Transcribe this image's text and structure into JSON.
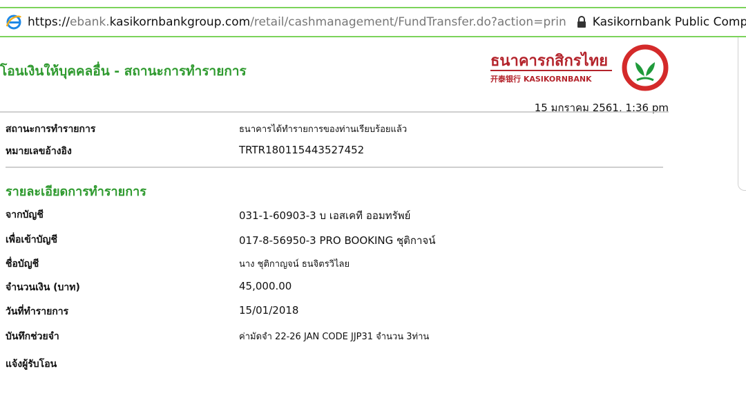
{
  "browser": {
    "url_scheme": "https://",
    "url_prefix": "ebank.",
    "url_domain": "kasikornbankgroup.com",
    "url_path": "/retail/cashmanagement/FundTransfer.do?action=prin",
    "site_identity": "Kasikornbank Public Company Li"
  },
  "header": {
    "page_title": "โอนเงินให้บุคคลอื่น - สถานะการทำรายการ",
    "logo_thai": "ธนาคารกสิกรไทย",
    "logo_sub": "开泰银行 KASIKORNBANK",
    "timestamp": "15 มกราคม 2561, 1:36 pm"
  },
  "status_rows": [
    {
      "label": "สถานะการทำรายการ",
      "value": "ธนาคารได้ทำรายการของท่านเรียบร้อยแล้ว"
    },
    {
      "label": "หมายเลขอ้างอิง",
      "value": "TRTR180115443527452"
    }
  ],
  "details": {
    "heading": "รายละเอียดการทำรายการ",
    "rows": [
      {
        "label": "จากบัญชี",
        "value": "031-1-60903-3 บ เอสเคที ออมทรัพย์"
      },
      {
        "label": "เพื่อเข้าบัญชี",
        "value": "017-8-56950-3 PRO BOOKING ชุติกาจน์"
      },
      {
        "label": "ชื่อบัญชี",
        "value": "นาง ชุติกาญจน์ ธนจิตรวิไลย"
      },
      {
        "label": "จำนวนเงิน (บาท)",
        "value": "45,000.00"
      },
      {
        "label": "วันที่ทำรายการ",
        "value": "15/01/2018"
      },
      {
        "label": "บันทึกช่วยจำ",
        "value": "ค่ามัดจำ 22-26 JAN CODE JJP31 จำนวน 3ท่าน"
      },
      {
        "label": "แจ้งผู้รับโอน",
        "value": ""
      }
    ]
  },
  "colors": {
    "accent_green": "#2f9a2f",
    "brand_red": "#b4232b",
    "brand_green": "#1f9a3a",
    "urlbar_border": "#7bd35a"
  },
  "icons": [
    "ie-icon",
    "lock-icon",
    "kasikorn-logo-icon"
  ]
}
